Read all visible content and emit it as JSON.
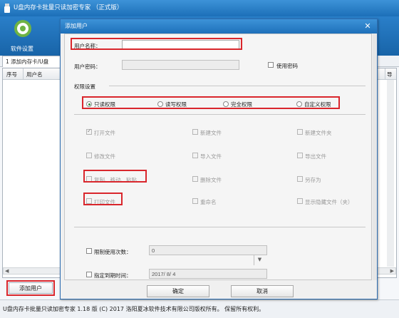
{
  "main": {
    "title": "U盘内存卡批量只读加密专家 （正式版）",
    "toolbar_label": "软件设置",
    "tab_label": "1 添加内存卡/U盘",
    "columns": [
      "序号",
      "用户名"
    ],
    "right_col_fragment": "导",
    "add_user_button": "添加用户",
    "status": "U盘内存卡批量只读加密专家 1.18 版 (C) 2017 洛阳夏冰软件技术有限公司版权所有。 保留所有权利。"
  },
  "dialog": {
    "title": "添加用户",
    "close_glyph": "✕",
    "username_label": "用户名称：",
    "username_value": "",
    "password_label": "用户密码：",
    "password_value": "",
    "use_password_label": "使用密码",
    "permission_group": "权限设置",
    "radios": [
      {
        "label": "只读权限",
        "selected": true
      },
      {
        "label": "读写权限",
        "selected": false
      },
      {
        "label": "完全权限",
        "selected": false
      },
      {
        "label": "自定义权限",
        "selected": false
      }
    ],
    "perms": [
      {
        "label": "打开文件",
        "checked": true
      },
      {
        "label": "新建文件",
        "checked": false
      },
      {
        "label": "新建文件夹",
        "checked": false
      },
      {
        "label": "修改文件",
        "checked": false
      },
      {
        "label": "导入文件",
        "checked": false
      },
      {
        "label": "导出文件",
        "checked": false
      },
      {
        "label": "复制、移动、粘贴",
        "checked": false
      },
      {
        "label": "删除文件",
        "checked": false
      },
      {
        "label": "另存为",
        "checked": false
      },
      {
        "label": "打印文件",
        "checked": false
      },
      {
        "label": "重命名",
        "checked": false
      },
      {
        "label": "显示隐藏文件（夹）",
        "checked": false
      }
    ],
    "limit_count_label": "限制使用次数：",
    "limit_count_value": "0",
    "expire_label": "指定到期时间：",
    "expire_value": "2017/ 8/ 4",
    "ok_button": "确定",
    "cancel_button": "取消"
  }
}
